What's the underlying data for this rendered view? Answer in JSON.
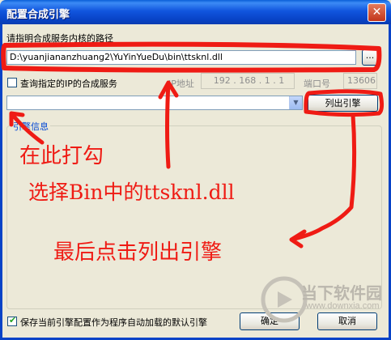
{
  "window": {
    "title": "配置合成引擎",
    "close_label": "✕"
  },
  "path_section": {
    "label": "请指明合成服务内核的路径",
    "path_value": "D:\\yuanjiananzhuang2\\YuYinYueDu\\bin\\ttsknl.dll",
    "browse_label": "..."
  },
  "ip_section": {
    "checkbox_label": "查询指定的IP的合成服务",
    "ip_label": "IP地址",
    "ip_value": "192 . 168 . 1 . 1",
    "port_label": "端口号",
    "port_value": "13606"
  },
  "engine": {
    "selected": "",
    "list_button": "列出引擎"
  },
  "engine_info": {
    "title": "引擎信息"
  },
  "footer": {
    "save_checkbox_label": "保存当前引擎配置作为程序自动加载的默认引擎",
    "save_checked": true,
    "ok_label": "确定",
    "cancel_label": "取消"
  },
  "annotations": {
    "check_here": "在此打勾",
    "select_bin": "选择Bin中的ttsknl.dll",
    "click_list": "最后点击列出引擎"
  },
  "watermark": {
    "site": "当下软件园",
    "url": "www.downxia.com"
  },
  "colors": {
    "annotation_red": "#ef1b14",
    "title_blue": "#0843c7"
  }
}
